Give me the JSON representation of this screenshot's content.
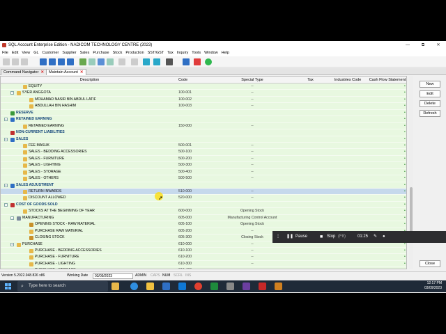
{
  "window": {
    "title": "SQL Account Enterprise Edition - NADICOM TECHNOLOGY CENTRE (2023)",
    "buttons": [
      "—",
      "⧉",
      "✕"
    ]
  },
  "menu": [
    "File",
    "Edit",
    "View",
    "GL",
    "Customer",
    "Supplier",
    "Sales",
    "Purchase",
    "Stock",
    "Production",
    "SST/GST",
    "Tax",
    "Inquiry",
    "Tools",
    "Window",
    "Help"
  ],
  "tabs": [
    {
      "label": "Command Navigator",
      "close": "✕"
    },
    {
      "label": "Maintain Account",
      "close": "✕"
    }
  ],
  "grid": {
    "headers": [
      "Description",
      "Code",
      "Special Type",
      "Tax",
      "Industries Code",
      "Cash Flow Statement"
    ],
    "rows": [
      {
        "desc": "EQUITY",
        "code": "",
        "special": "--",
        "level": 2,
        "bold": false,
        "expander": false,
        "icon": "folder",
        "selected": false
      },
      {
        "desc": "SYER ANGGOTA",
        "code": "100-001",
        "special": "--",
        "level": 1,
        "bold": false,
        "expander": true,
        "icon": "folder",
        "selected": false
      },
      {
        "desc": "MOHAMAD NASIR BIN ABDUL LATIF",
        "code": "100-002",
        "special": "--",
        "level": 3,
        "bold": false,
        "expander": false,
        "icon": "folder",
        "selected": false
      },
      {
        "desc": "ABDULLAH BIN HASHIM",
        "code": "100-003",
        "special": "--",
        "level": 3,
        "bold": false,
        "expander": false,
        "icon": "folder",
        "selected": false
      },
      {
        "desc": "RESERVE",
        "code": "",
        "special": "",
        "level": 0,
        "bold": true,
        "expander": false,
        "icon": "green",
        "selected": false
      },
      {
        "desc": "RETAINED EARNING",
        "code": "",
        "special": "",
        "level": 0,
        "bold": true,
        "expander": true,
        "icon": "blue",
        "selected": false
      },
      {
        "desc": "RETAINED EARNING",
        "code": "150-000",
        "special": "--",
        "level": 2,
        "bold": false,
        "expander": false,
        "icon": "folder",
        "selected": false
      },
      {
        "desc": "NON-CURRENT LIABILITIES",
        "code": "",
        "special": "",
        "level": 0,
        "bold": true,
        "expander": false,
        "icon": "red",
        "selected": false
      },
      {
        "desc": "SALES",
        "code": "",
        "special": "",
        "level": 0,
        "bold": true,
        "expander": true,
        "icon": "blue",
        "selected": false
      },
      {
        "desc": "FEE MASUK",
        "code": "500-001",
        "special": "--",
        "level": 2,
        "bold": false,
        "expander": false,
        "icon": "folder",
        "selected": false
      },
      {
        "desc": "SALES - BEDDING ACCESSORIES",
        "code": "500-100",
        "special": "--",
        "level": 2,
        "bold": false,
        "expander": false,
        "icon": "folder",
        "selected": false
      },
      {
        "desc": "SALES - FURNITURE",
        "code": "500-200",
        "special": "--",
        "level": 2,
        "bold": false,
        "expander": false,
        "icon": "folder",
        "selected": false
      },
      {
        "desc": "SALES - LIGHTING",
        "code": "500-300",
        "special": "--",
        "level": 2,
        "bold": false,
        "expander": false,
        "icon": "folder",
        "selected": false
      },
      {
        "desc": "SALES - STORAGE",
        "code": "500-400",
        "special": "--",
        "level": 2,
        "bold": false,
        "expander": false,
        "icon": "folder",
        "selected": false
      },
      {
        "desc": "SALES - OTHERS",
        "code": "500-500",
        "special": "--",
        "level": 2,
        "bold": false,
        "expander": false,
        "icon": "folder",
        "selected": false
      },
      {
        "desc": "SALES ADJUSTMENT",
        "code": "",
        "special": "",
        "level": 0,
        "bold": true,
        "expander": true,
        "icon": "blue",
        "selected": false
      },
      {
        "desc": "RETURN INWARDS",
        "code": "510-000",
        "special": "--",
        "level": 2,
        "bold": false,
        "expander": false,
        "icon": "folder",
        "selected": true
      },
      {
        "desc": "DISCOUNT ALLOWED",
        "code": "520-000",
        "special": "--",
        "level": 2,
        "bold": false,
        "expander": false,
        "icon": "folder",
        "selected": false
      },
      {
        "desc": "COST OF GOODS SOLD",
        "code": "",
        "special": "",
        "level": 0,
        "bold": true,
        "expander": true,
        "icon": "red",
        "selected": false
      },
      {
        "desc": "STOCKS AT THE BEGINNING OF YEAR",
        "code": "600-000",
        "special": "Opening Stock",
        "level": 2,
        "bold": false,
        "expander": false,
        "icon": "folder",
        "selected": false
      },
      {
        "desc": "MANUFACTURING",
        "code": "605-000",
        "special": "Manufacturing Control Account",
        "level": 1,
        "bold": false,
        "expander": true,
        "icon": "gear",
        "selected": false
      },
      {
        "desc": "OPENING STOCK - RAW MATERIAL",
        "code": "605-100",
        "special": "Opening Stock",
        "level": 3,
        "bold": false,
        "expander": false,
        "icon": "box",
        "selected": false
      },
      {
        "desc": "PURCHASE RAW MATERIAL",
        "code": "605-200",
        "special": "--",
        "level": 3,
        "bold": false,
        "expander": false,
        "icon": "folder",
        "selected": false
      },
      {
        "desc": "CLOSING STOCK",
        "code": "605-300",
        "special": "Closing Stock",
        "level": 3,
        "bold": false,
        "expander": false,
        "icon": "box",
        "selected": false
      },
      {
        "desc": "PURCHASE",
        "code": "610-000",
        "special": "--",
        "level": 1,
        "bold": false,
        "expander": true,
        "icon": "folder",
        "selected": false
      },
      {
        "desc": "PURCHASE - BEDDING ACCESSORIES",
        "code": "610-100",
        "special": "--",
        "level": 3,
        "bold": false,
        "expander": false,
        "icon": "folder",
        "selected": false
      },
      {
        "desc": "PURCHASE - FURNITURE",
        "code": "610-200",
        "special": "--",
        "level": 3,
        "bold": false,
        "expander": false,
        "icon": "folder",
        "selected": false
      },
      {
        "desc": "PURCHASE - LIGHTING",
        "code": "610-300",
        "special": "--",
        "level": 3,
        "bold": false,
        "expander": false,
        "icon": "folder",
        "selected": false
      },
      {
        "desc": "PURCHASE - STORAGE",
        "code": "610-400",
        "special": "--",
        "level": 3,
        "bold": false,
        "expander": false,
        "icon": "folder",
        "selected": false
      }
    ]
  },
  "side_buttons": {
    "new": "New",
    "edit": "Edit",
    "delete": "Delete",
    "refresh": "Refresh",
    "close": "Close"
  },
  "status": {
    "version": "Version 5.2022.948.826 x86",
    "working_date_label": "Working Date",
    "working_date": "03/09/2023",
    "user": "ADMIN",
    "caps": "CAPS",
    "num": "NUM",
    "scrl": "SCRL",
    "ins": "INS"
  },
  "recorder": {
    "pause": "Pause",
    "stop": "Stop",
    "stop_key": "(F8)",
    "time": "01:25"
  },
  "taskbar": {
    "search_placeholder": "Type here to search",
    "clock_time": "12:17 PM",
    "clock_date": "03/09/2023"
  },
  "colors": {
    "row_bg": "#e8f8e0",
    "selected_row": "#c6d9ec",
    "header_text": "#13457a",
    "taskbar": "#1f2a38"
  }
}
